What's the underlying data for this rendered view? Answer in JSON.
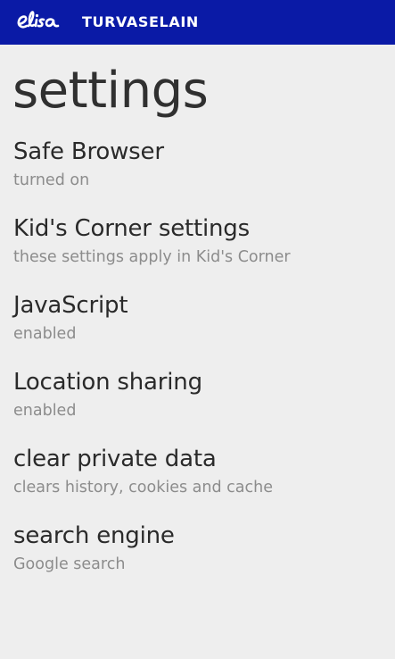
{
  "header": {
    "logo_text": "elisa",
    "brand_name": "TURVASELAIN"
  },
  "page": {
    "title": "settings"
  },
  "settings": [
    {
      "label": "Safe Browser",
      "value": "turned on"
    },
    {
      "label": "Kid's Corner settings",
      "value": "these settings apply in Kid's Corner"
    },
    {
      "label": "JavaScript",
      "value": "enabled"
    },
    {
      "label": "Location sharing",
      "value": "enabled"
    },
    {
      "label": "clear private data",
      "value": "clears history, cookies and cache"
    },
    {
      "label": "search engine",
      "value": "Google search"
    }
  ],
  "colors": {
    "header_background": "#0a1aa6",
    "page_background": "#eeeeee",
    "label_text": "#2a2a2a",
    "value_text": "#8c8c8c"
  }
}
